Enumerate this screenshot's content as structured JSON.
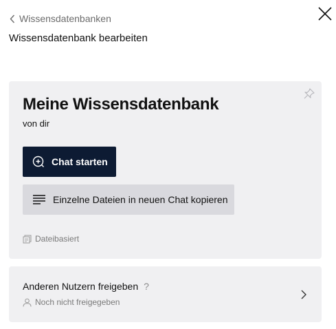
{
  "header": {
    "back_label": "Wissensdatenbanken",
    "page_title": "Wissensdatenbank bearbeiten"
  },
  "knowledge_base": {
    "name": "Meine Wissensdatenbank",
    "owner": "von dir",
    "start_chat_label": "Chat starten",
    "copy_files_label": "Einzelne Dateien in neuen Chat kopieren",
    "type_label": "Dateibasiert"
  },
  "sharing": {
    "title": "Anderen Nutzern freigeben",
    "help": "?",
    "status": "Noch nicht freigegeben"
  },
  "icons": {
    "back": "chevron-left-icon",
    "close": "close-icon",
    "pin": "pin-icon",
    "chat": "chat-plus-icon",
    "lines": "lines-icon",
    "files": "files-icon",
    "user": "user-icon",
    "forward": "chevron-right-icon"
  },
  "colors": {
    "primary_button": "#0d1b33",
    "secondary_button": "#d9d9de",
    "card_background": "#f0f0f2",
    "muted_text": "#7a7a7a"
  }
}
